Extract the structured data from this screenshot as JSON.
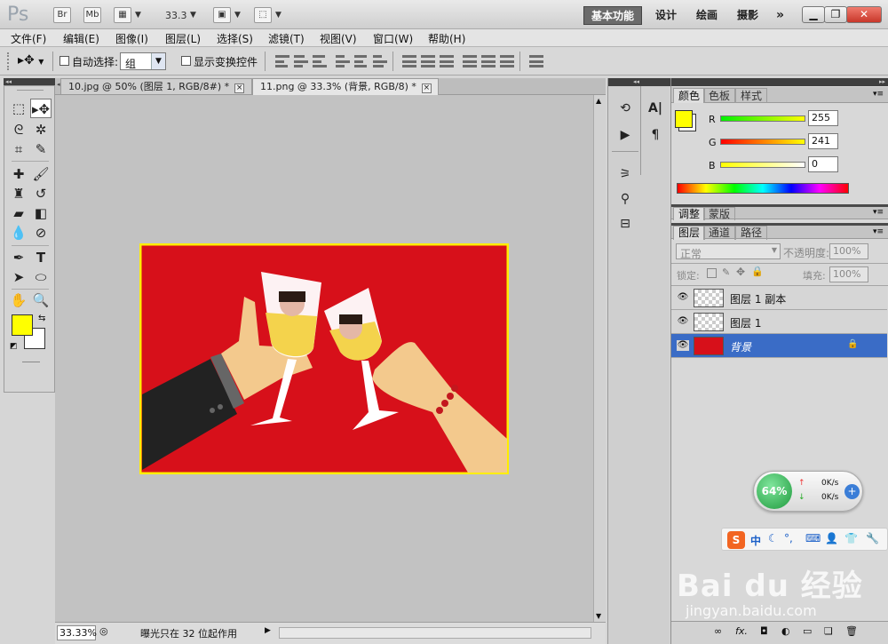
{
  "app": {
    "logo": "Ps",
    "zoom_display": "33.3"
  },
  "appbar": {
    "bridge": "Br",
    "minibridge": "Mb",
    "workspaces": [
      "基本功能",
      "设计",
      "绘画",
      "摄影"
    ],
    "more": "»"
  },
  "menu": [
    "文件(F)",
    "编辑(E)",
    "图像(I)",
    "图层(L)",
    "选择(S)",
    "滤镜(T)",
    "视图(V)",
    "窗口(W)",
    "帮助(H)"
  ],
  "options": {
    "auto_select_label": "自动选择:",
    "auto_select_value": "组",
    "show_transform_label": "显示变换控件"
  },
  "tabs": [
    {
      "label": "10.jpg @ 50% (图层 1, RGB/8#) *",
      "active": false
    },
    {
      "label": "11.png @ 33.3% (背景, RGB/8) *",
      "active": true
    }
  ],
  "status": {
    "zoom": "33.33%",
    "message": "曝光只在 32 位起作用"
  },
  "color_panel": {
    "tabs": [
      "颜色",
      "色板",
      "样式"
    ],
    "fg_color": "#ffff00",
    "channels": [
      {
        "name": "R",
        "value": "255"
      },
      {
        "name": "G",
        "value": "241"
      },
      {
        "name": "B",
        "value": "0"
      }
    ]
  },
  "adjust_panel": {
    "tabs": [
      "调整",
      "蒙版"
    ]
  },
  "layers_panel": {
    "tabs": [
      "图层",
      "通道",
      "路径"
    ],
    "blend_mode": "正常",
    "opacity_label": "不透明度:",
    "opacity_value": "100%",
    "lock_label": "锁定:",
    "fill_label": "填充:",
    "fill_value": "100%",
    "layers": [
      {
        "name": "图层 1 副本",
        "selected": false
      },
      {
        "name": "图层 1",
        "selected": false
      },
      {
        "name": "背景",
        "selected": true
      }
    ]
  },
  "network_widget": {
    "percent": "64%",
    "up": "0K/s",
    "down": "0K/s"
  },
  "ime": {
    "label": "中"
  },
  "watermark": {
    "brand": "Bai du 经验",
    "url": "jingyan.baidu.com"
  },
  "colors": {
    "canvas_bg": "#d7101a",
    "canvas_border": "#ffee00",
    "selected_layer": "#3a6cc6",
    "fg_swatch": "#ffff00"
  }
}
